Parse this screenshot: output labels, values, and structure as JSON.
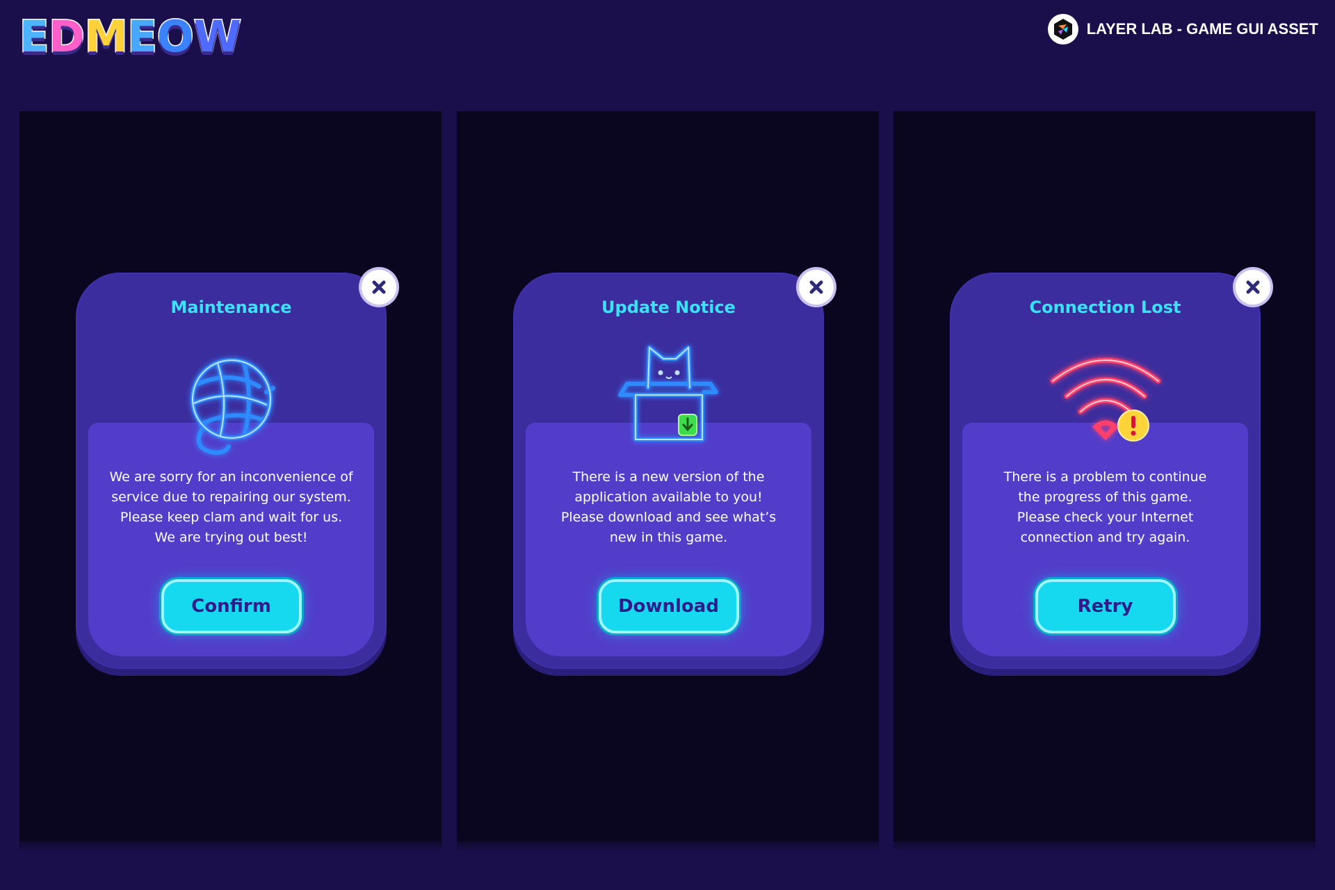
{
  "header": {
    "logo_letters": [
      "E",
      "D",
      "M",
      "E",
      "O",
      "W"
    ],
    "brand_text": "LAYER LAB - GAME GUI ASSET"
  },
  "popups": [
    {
      "title": "Maintenance",
      "message": "We are sorry for an inconvenience of\nservice due to repairing our system.\nPlease keep clam and wait for us.\nWe are trying out best!",
      "button": "Confirm",
      "icon": "yarn-ball-icon"
    },
    {
      "title": "Update Notice",
      "message": "There is a new version of the\napplication available to you!\nPlease download and see what’s\nnew in this game.",
      "button": "Download",
      "icon": "cat-in-box-icon"
    },
    {
      "title": "Connection Lost",
      "message": "There is a problem to continue\nthe progress of this game.\nPlease check your Internet\nconnection and try again.",
      "button": "Retry",
      "icon": "wifi-warning-icon"
    }
  ],
  "colors": {
    "background": "#1b0f4b",
    "panel": "#0b0620",
    "popup": "#3b2d9e",
    "popup_inner": "#523dca",
    "accent": "#39e3f5",
    "neon_blue": "#2f8bff",
    "neon_red": "#ff3f6a"
  }
}
